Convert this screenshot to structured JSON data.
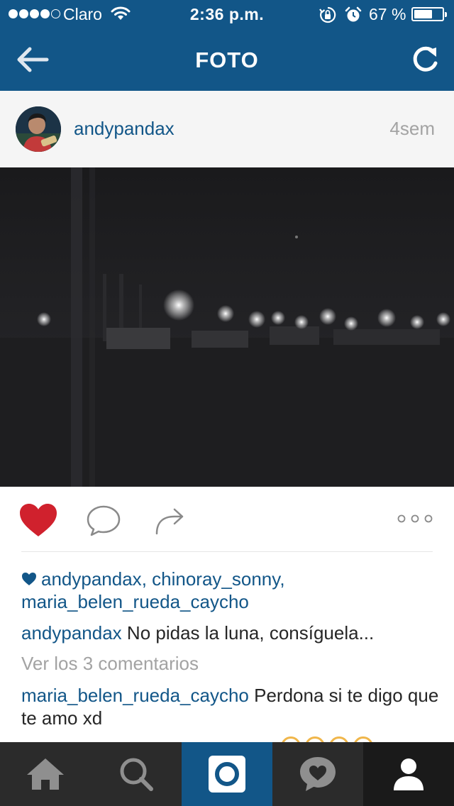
{
  "status_bar": {
    "carrier": "Claro",
    "time": "2:36 p.m.",
    "battery_percent": "67 %",
    "battery_level": 0.67,
    "signal_bars": 4
  },
  "nav": {
    "title": "FOTO",
    "back_icon": "back-arrow-icon",
    "refresh_icon": "refresh-icon"
  },
  "post": {
    "username": "andypandax",
    "age": "4sem",
    "liked": true,
    "likes": [
      "andypandax",
      "chinoray_sonny",
      "maria_belen_rueda_caycho"
    ],
    "caption": {
      "user": "andypandax",
      "text": "No pidas la luna, consíguela..."
    },
    "view_comments": "Ver los 3 comentarios",
    "comments": [
      {
        "user": "maria_belen_rueda_caycho",
        "text": "Perdona si te digo que te amo xd"
      }
    ]
  },
  "colors": {
    "brand": "#125688",
    "like": "#d0212d",
    "meta_gray": "#a3a3a3",
    "tab_bar": "#2b2b2b"
  },
  "tabs": [
    {
      "name": "home",
      "icon": "home-icon"
    },
    {
      "name": "explore",
      "icon": "search-icon"
    },
    {
      "name": "camera",
      "icon": "camera-icon",
      "active": true
    },
    {
      "name": "activity",
      "icon": "activity-heart-icon"
    },
    {
      "name": "profile",
      "icon": "profile-icon"
    }
  ]
}
